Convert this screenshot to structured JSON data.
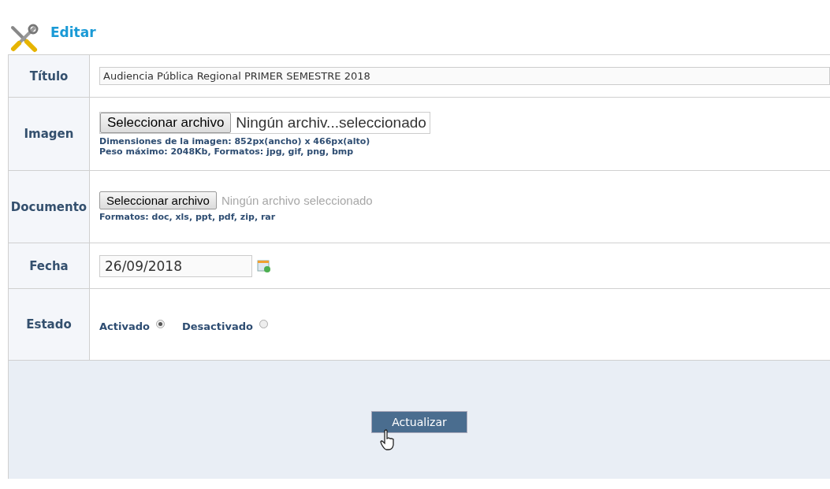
{
  "header": {
    "title": "Editar"
  },
  "rows": [
    {
      "kind": "text",
      "label": "Título",
      "value": "Audiencia Pública Regional PRIMER SEMESTRE 2018"
    },
    {
      "kind": "file-large",
      "label": "Imagen",
      "button": "Seleccionar archivo",
      "status": "Ningún archiv...seleccionado",
      "notes": [
        "Dimensiones de la imagen: 852px(ancho) x 466px(alto)",
        "Peso máximo: 2048Kb, Formatos: jpg, gif, png, bmp"
      ]
    },
    {
      "kind": "file",
      "label": "Documento",
      "button": "Seleccionar archivo",
      "status": "Ningún archivo seleccionado",
      "notes": [
        "Formatos: doc, xls, ppt, pdf, zip, rar"
      ]
    },
    {
      "kind": "date",
      "label": "Fecha",
      "value": "26/09/2018"
    },
    {
      "kind": "radio",
      "label": "Estado",
      "options": [
        {
          "label": "Activado",
          "selected": true
        },
        {
          "label": "Desactivado",
          "selected": false
        }
      ]
    }
  ],
  "submit": {
    "label": "Actualizar"
  }
}
